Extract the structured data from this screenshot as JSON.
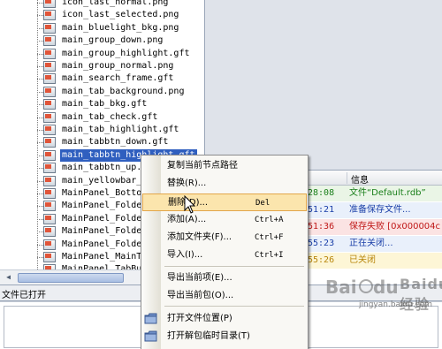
{
  "tree": {
    "items": [
      {
        "name": "icon_last_normal.png",
        "selected": false
      },
      {
        "name": "icon_last_selected.png",
        "selected": false
      },
      {
        "name": "main_bluelight_bkg.png",
        "selected": false
      },
      {
        "name": "main_group_down.png",
        "selected": false
      },
      {
        "name": "main_group_highlight.gft",
        "selected": false
      },
      {
        "name": "main_group_normal.png",
        "selected": false
      },
      {
        "name": "main_search_frame.gft",
        "selected": false
      },
      {
        "name": "main_tab_background.png",
        "selected": false
      },
      {
        "name": "main_tab_bkg.gft",
        "selected": false
      },
      {
        "name": "main_tab_check.gft",
        "selected": false
      },
      {
        "name": "main_tab_highlight.gft",
        "selected": false
      },
      {
        "name": "main_tabbtn_down.gft",
        "selected": false
      },
      {
        "name": "main_tabbtn_highlight.gft",
        "selected": true
      },
      {
        "name": "main_tabbtn_up.png",
        "selected": false
      },
      {
        "name": "main_yellowbar_b",
        "selected": false
      },
      {
        "name": "MainPanel_Bottom",
        "selected": false
      },
      {
        "name": "MainPanel_Folder",
        "selected": false
      },
      {
        "name": "MainPanel_Folder",
        "selected": false
      },
      {
        "name": "MainPanel_Folder",
        "selected": false
      },
      {
        "name": "MainPanel_Folder",
        "selected": false
      },
      {
        "name": "MainPanel_MainTa",
        "selected": false
      },
      {
        "name": "MainPanel_TabBut",
        "selected": false
      }
    ]
  },
  "log": {
    "header_info": "信息",
    "rows": [
      {
        "time": "28:08",
        "message": "文件“Default.rdb”",
        "color": "#1a7f1a"
      },
      {
        "time": "51:21",
        "message": "准备保存文件...",
        "color": "#1a3fa8"
      },
      {
        "time": "51:36",
        "message": "保存失败 [0x000004c",
        "color": "#c01818"
      },
      {
        "time": "55:23",
        "message": "正在关闭...",
        "color": "#1a3fa8"
      },
      {
        "time": "55:26",
        "message": "已关闭",
        "color": "#b8860b"
      }
    ],
    "row_backgrounds": [
      "#eaf5e6",
      "#e9f0fb",
      "#fbe3e3",
      "#e9f0fb",
      "#fdf6d6"
    ]
  },
  "status": {
    "text": "文件已打开"
  },
  "context_menu": {
    "items": [
      {
        "label": "复制当前节点路径",
        "shortcut": ""
      },
      {
        "label": "替换(R)...",
        "shortcut": ""
      },
      {
        "label": "删除(D)...",
        "shortcut": "Del"
      },
      {
        "label": "添加(A)...",
        "shortcut": "Ctrl+A"
      },
      {
        "label": "添加文件夹(F)...",
        "shortcut": "Ctrl+F"
      },
      {
        "label": "导入(I)...",
        "shortcut": "Ctrl+I"
      },
      {
        "label": "导出当前项(E)...",
        "shortcut": ""
      },
      {
        "label": "导出当前包(O)...",
        "shortcut": ""
      },
      {
        "label": "打开文件位置(P)",
        "shortcut": ""
      },
      {
        "label": "打开解包临时目录(T)",
        "shortcut": ""
      }
    ],
    "hover_item": "删除(D)..."
  },
  "watermark": {
    "brand": "Baidu 经验",
    "site": "jingyan.baidu.com"
  },
  "colors": {
    "selection": "#2f5fbf",
    "menu_hover": "#fbe5ad",
    "menu_hover_border": "#e3a64a"
  }
}
